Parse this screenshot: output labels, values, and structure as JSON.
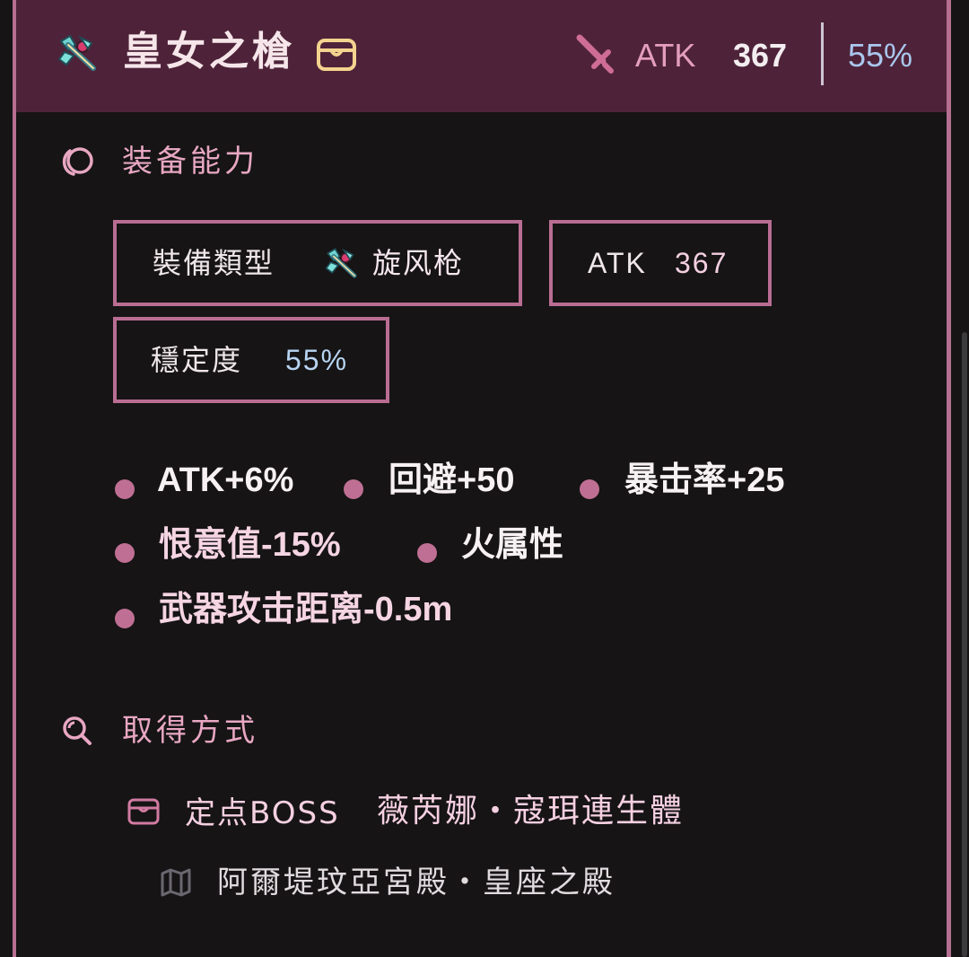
{
  "header": {
    "title": "皇女之槍",
    "atk_label": "ATK",
    "atk_value": "367",
    "stability_value": "55%"
  },
  "ability": {
    "section_title": "装备能力",
    "type_label": "裝備類型",
    "type_value": "旋风枪",
    "atk_label": "ATK",
    "atk_value": "367",
    "stability_label": "穩定度",
    "stability_value": "55%",
    "stats": [
      "ATK+6%",
      "回避+50",
      "暴击率+25",
      "恨意值-15%",
      "火属性",
      "武器攻击距离-0.5m"
    ]
  },
  "obtain": {
    "section_title": "取得方式",
    "source_prefix": "定点BOSS",
    "source_name": "薇芮娜・寇珥連生體",
    "location": "阿爾堤玟亞宮殿・皇座之殿"
  },
  "colors": {
    "header_bg": "#4e2339",
    "accent_pink": "#b96d92",
    "stability_blue": "#aac7ee",
    "page_bg": "#161415"
  },
  "icons": [
    "halberd-icon",
    "chest-icon",
    "sword-icon",
    "swirl-icon",
    "search-icon",
    "map-icon"
  ]
}
